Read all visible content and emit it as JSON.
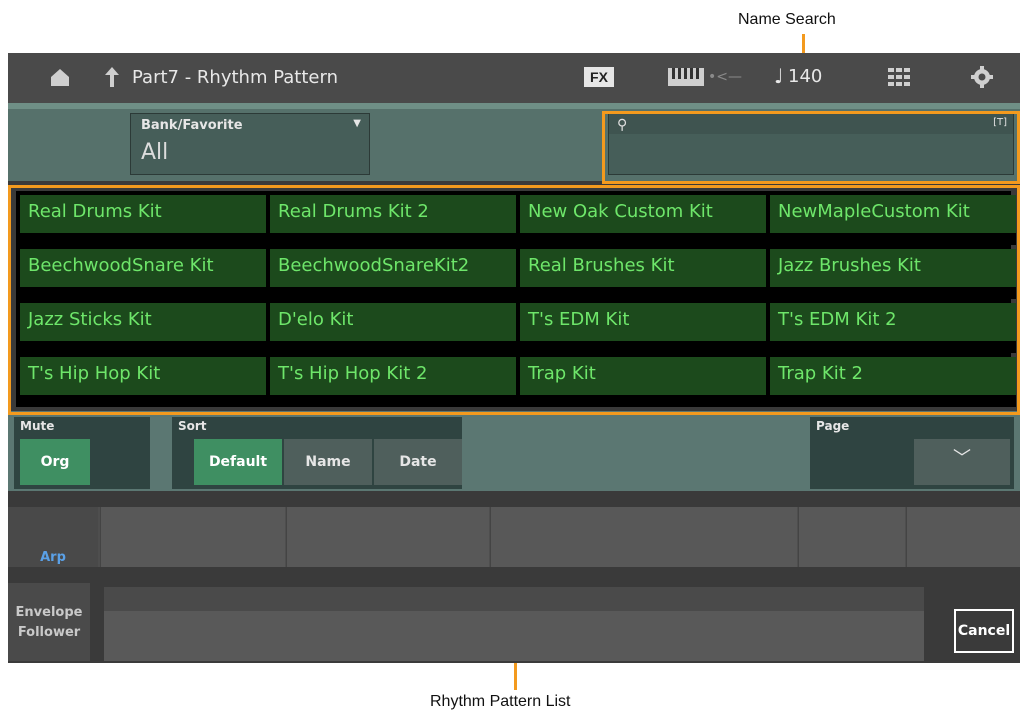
{
  "callouts": {
    "top": "Name Search",
    "bottom": "Rhythm Pattern List"
  },
  "header": {
    "title": "Part7 - Rhythm Pattern",
    "fx": "FX",
    "tempo": "140"
  },
  "bank": {
    "label": "Bank/Favorite",
    "value": "All"
  },
  "search": {
    "value": "",
    "keyboard_hint": "[T]"
  },
  "patterns": [
    "Real Drums Kit",
    "Real Drums Kit 2",
    "New Oak Custom Kit",
    "NewMapleCustom Kit",
    "BeechwoodSnare Kit",
    "BeechwoodSnareKit2",
    "Real Brushes Kit",
    "Jazz Brushes Kit",
    "Jazz Sticks Kit",
    "D'elo Kit",
    "T's EDM Kit",
    "T's EDM Kit 2",
    "T's Hip Hop Kit",
    "T's Hip Hop Kit 2",
    "Trap Kit",
    "Trap Kit 2"
  ],
  "mute": {
    "label": "Mute",
    "button": "Org"
  },
  "sort": {
    "label": "Sort",
    "options": [
      "Default",
      "Name",
      "Date"
    ],
    "selected": "Default"
  },
  "page": {
    "label": "Page"
  },
  "lower": {
    "arp": "Arp",
    "envelope_follower": "Envelope Follower",
    "cancel": "Cancel"
  },
  "colors": {
    "accent_orange": "#f39a1e",
    "cell_green": "#1c4a1c",
    "text_green": "#6ee66a",
    "button_green": "#3f8f62"
  }
}
